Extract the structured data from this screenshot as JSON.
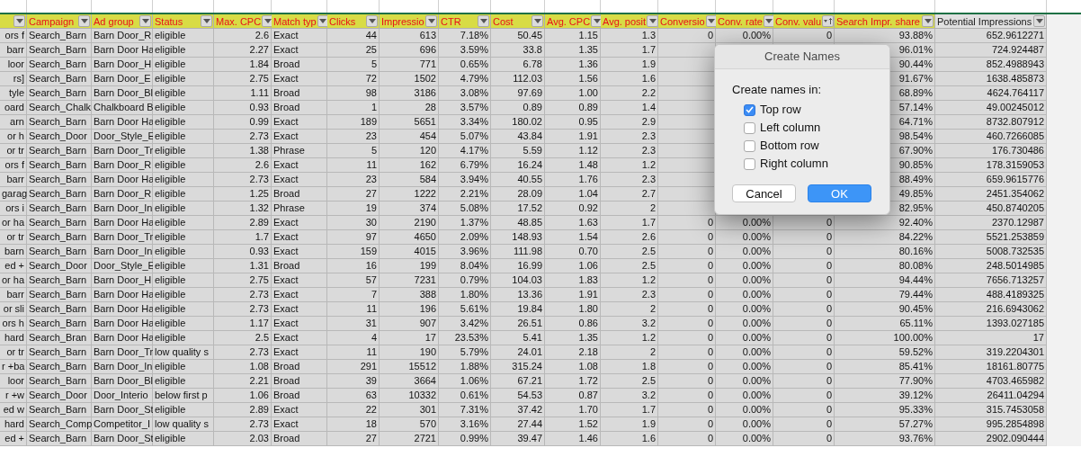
{
  "sheet": {
    "columns": [
      {
        "kind": "text",
        "highlighted": true,
        "sorted": false
      },
      {
        "label": "Campaign",
        "kind": "text",
        "highlighted": true,
        "sorted": false
      },
      {
        "label": "Ad group",
        "kind": "text",
        "highlighted": true,
        "sorted": false
      },
      {
        "label": "Status",
        "kind": "text",
        "highlighted": true,
        "sorted": false
      },
      {
        "label": "Max. CPC",
        "kind": "number",
        "highlighted": true,
        "sorted": false
      },
      {
        "label": "Match typ",
        "kind": "text",
        "highlighted": true,
        "sorted": false
      },
      {
        "label": "Clicks",
        "kind": "number",
        "highlighted": true,
        "sorted": false
      },
      {
        "label": "Impressio",
        "kind": "number",
        "highlighted": true,
        "sorted": false
      },
      {
        "label": "CTR",
        "kind": "number",
        "highlighted": true,
        "sorted": false
      },
      {
        "label": "Cost",
        "kind": "number",
        "highlighted": true,
        "sorted": false
      },
      {
        "label": "Avg. CPC",
        "kind": "number",
        "highlighted": true,
        "sorted": false
      },
      {
        "label": "Avg. posit",
        "kind": "number",
        "highlighted": true,
        "sorted": false
      },
      {
        "label": "Conversio",
        "kind": "number",
        "highlighted": true,
        "sorted": false
      },
      {
        "label": "Conv. rate",
        "kind": "number",
        "highlighted": true,
        "sorted": false
      },
      {
        "label": "Conv. valu",
        "kind": "number",
        "highlighted": true,
        "sorted": true
      },
      {
        "label": "Search Impr. share",
        "kind": "number",
        "highlighted": true,
        "sorted": false
      },
      {
        "label": "Potential Impressions",
        "kind": "number",
        "highlighted": false,
        "sorted": false
      }
    ],
    "rows": [
      [
        "ors f",
        "Search_Barn",
        "Barn Door_R",
        "eligible",
        "2.6",
        "Exact",
        "44",
        "613",
        "7.18%",
        "50.45",
        "1.15",
        "1.3",
        "0",
        "0.00%",
        "0",
        "93.88%",
        "652.9612271"
      ],
      [
        "barr",
        "Search_Barn",
        "Barn Door Ha",
        "eligible",
        "2.27",
        "Exact",
        "25",
        "696",
        "3.59%",
        "33.8",
        "1.35",
        "1.7",
        null,
        null,
        null,
        "96.01%",
        "724.924487"
      ],
      [
        "loor",
        "Search_Barn",
        "Barn Door_H",
        "eligible",
        "1.84",
        "Broad",
        "5",
        "771",
        "0.65%",
        "6.78",
        "1.36",
        "1.9",
        null,
        null,
        null,
        "90.44%",
        "852.4988943"
      ],
      [
        "rs]",
        "Search_Barn",
        "Barn Door_E",
        "eligible",
        "2.75",
        "Exact",
        "72",
        "1502",
        "4.79%",
        "112.03",
        "1.56",
        "1.6",
        null,
        null,
        null,
        "91.67%",
        "1638.485873"
      ],
      [
        "tyle",
        "Search_Barn",
        "Barn Door_Bl",
        "eligible",
        "1.11",
        "Broad",
        "98",
        "3186",
        "3.08%",
        "97.69",
        "1.00",
        "2.2",
        null,
        null,
        null,
        "68.89%",
        "4624.764117"
      ],
      [
        "oard",
        "Search_Chalk",
        "Chalkboard B",
        "eligible",
        "0.93",
        "Broad",
        "1",
        "28",
        "3.57%",
        "0.89",
        "0.89",
        "1.4",
        null,
        null,
        null,
        "57.14%",
        "49.00245012"
      ],
      [
        "arn",
        "Search_Barn",
        "Barn Door Ha",
        "eligible",
        "0.99",
        "Exact",
        "189",
        "5651",
        "3.34%",
        "180.02",
        "0.95",
        "2.9",
        null,
        null,
        null,
        "64.71%",
        "8732.807912"
      ],
      [
        "or h",
        "Search_Door",
        "Door_Style_E",
        "eligible",
        "2.73",
        "Exact",
        "23",
        "454",
        "5.07%",
        "43.84",
        "1.91",
        "2.3",
        null,
        null,
        null,
        "98.54%",
        "460.7266085"
      ],
      [
        "or tr",
        "Search_Barn",
        "Barn Door_Tr",
        "eligible",
        "1.38",
        "Phrase",
        "5",
        "120",
        "4.17%",
        "5.59",
        "1.12",
        "2.3",
        null,
        null,
        null,
        "67.90%",
        "176.730486"
      ],
      [
        "ors f",
        "Search_Barn",
        "Barn Door_R",
        "eligible",
        "2.6",
        "Exact",
        "11",
        "162",
        "6.79%",
        "16.24",
        "1.48",
        "1.2",
        null,
        null,
        null,
        "90.85%",
        "178.3159053"
      ],
      [
        "barr",
        "Search_Barn",
        "Barn Door Ha",
        "eligible",
        "2.73",
        "Exact",
        "23",
        "584",
        "3.94%",
        "40.55",
        "1.76",
        "2.3",
        null,
        null,
        null,
        "88.49%",
        "659.9615776"
      ],
      [
        "garag",
        "Search_Barn",
        "Barn Door_R",
        "eligible",
        "1.25",
        "Broad",
        "27",
        "1222",
        "2.21%",
        "28.09",
        "1.04",
        "2.7",
        null,
        null,
        null,
        "49.85%",
        "2451.354062"
      ],
      [
        "ors i",
        "Search_Barn",
        "Barn Door_In",
        "eligible",
        "1.32",
        "Phrase",
        "19",
        "374",
        "5.08%",
        "17.52",
        "0.92",
        "2",
        null,
        null,
        null,
        "82.95%",
        "450.8740205"
      ],
      [
        "or ha",
        "Search_Barn",
        "Barn Door Ha",
        "eligible",
        "2.89",
        "Exact",
        "30",
        "2190",
        "1.37%",
        "48.85",
        "1.63",
        "1.7",
        "0",
        "0.00%",
        "0",
        "92.40%",
        "2370.12987"
      ],
      [
        "or tr",
        "Search_Barn",
        "Barn Door_Tr",
        "eligible",
        "1.7",
        "Exact",
        "97",
        "4650",
        "2.09%",
        "148.93",
        "1.54",
        "2.6",
        "0",
        "0.00%",
        "0",
        "84.22%",
        "5521.253859"
      ],
      [
        "barn",
        "Search_Barn",
        "Barn Door_In",
        "eligible",
        "0.93",
        "Exact",
        "159",
        "4015",
        "3.96%",
        "111.98",
        "0.70",
        "2.5",
        "0",
        "0.00%",
        "0",
        "80.16%",
        "5008.732535"
      ],
      [
        "ed +",
        "Search_Door",
        "Door_Style_E",
        "eligible",
        "1.31",
        "Broad",
        "16",
        "199",
        "8.04%",
        "16.99",
        "1.06",
        "2.5",
        "0",
        "0.00%",
        "0",
        "80.08%",
        "248.5014985"
      ],
      [
        "or ha",
        "Search_Barn",
        "Barn Door_H",
        "eligible",
        "2.75",
        "Exact",
        "57",
        "7231",
        "0.79%",
        "104.03",
        "1.83",
        "1.2",
        "0",
        "0.00%",
        "0",
        "94.44%",
        "7656.713257"
      ],
      [
        "barr",
        "Search_Barn",
        "Barn Door Ha",
        "eligible",
        "2.73",
        "Exact",
        "7",
        "388",
        "1.80%",
        "13.36",
        "1.91",
        "2.3",
        "0",
        "0.00%",
        "0",
        "79.44%",
        "488.4189325"
      ],
      [
        "or sli",
        "Search_Barn",
        "Barn Door Ha",
        "eligible",
        "2.73",
        "Exact",
        "11",
        "196",
        "5.61%",
        "19.84",
        "1.80",
        "2",
        "0",
        "0.00%",
        "0",
        "90.45%",
        "216.6943062"
      ],
      [
        "ors h",
        "Search_Barn",
        "Barn Door Ha",
        "eligible",
        "1.17",
        "Exact",
        "31",
        "907",
        "3.42%",
        "26.51",
        "0.86",
        "3.2",
        "0",
        "0.00%",
        "0",
        "65.11%",
        "1393.027185"
      ],
      [
        "hard",
        "Search_Bran",
        "Barn Door Ha",
        "eligible",
        "2.5",
        "Exact",
        "4",
        "17",
        "23.53%",
        "5.41",
        "1.35",
        "1.2",
        "0",
        "0.00%",
        "0",
        "100.00%",
        "17"
      ],
      [
        "or tr",
        "Search_Barn",
        "Barn Door_Tr",
        "low quality s",
        "2.73",
        "Exact",
        "11",
        "190",
        "5.79%",
        "24.01",
        "2.18",
        "2",
        "0",
        "0.00%",
        "0",
        "59.52%",
        "319.2204301"
      ],
      [
        "r +ba",
        "Search_Barn",
        "Barn Door_In",
        "eligible",
        "1.08",
        "Broad",
        "291",
        "15512",
        "1.88%",
        "315.24",
        "1.08",
        "1.8",
        "0",
        "0.00%",
        "0",
        "85.41%",
        "18161.80775"
      ],
      [
        "loor",
        "Search_Barn",
        "Barn Door_Bl",
        "eligible",
        "2.21",
        "Broad",
        "39",
        "3664",
        "1.06%",
        "67.21",
        "1.72",
        "2.5",
        "0",
        "0.00%",
        "0",
        "77.90%",
        "4703.465982"
      ],
      [
        "r +w",
        "Search_Door",
        "Door_Interio",
        "below first p",
        "1.06",
        "Broad",
        "63",
        "10332",
        "0.61%",
        "54.53",
        "0.87",
        "3.2",
        "0",
        "0.00%",
        "0",
        "39.12%",
        "26411.04294"
      ],
      [
        "ed w",
        "Search_Barn",
        "Barn Door_St",
        "eligible",
        "2.89",
        "Exact",
        "22",
        "301",
        "7.31%",
        "37.42",
        "1.70",
        "1.7",
        "0",
        "0.00%",
        "0",
        "95.33%",
        "315.7453058"
      ],
      [
        "hard",
        "Search_Comp",
        "Competitor_I",
        "low quality s",
        "2.73",
        "Exact",
        "18",
        "570",
        "3.16%",
        "27.44",
        "1.52",
        "1.9",
        "0",
        "0.00%",
        "0",
        "57.27%",
        "995.2854898"
      ],
      [
        "ed +",
        "Search_Barn",
        "Barn Door_St",
        "eligible",
        "2.03",
        "Broad",
        "27",
        "2721",
        "0.99%",
        "39.47",
        "1.46",
        "1.6",
        "0",
        "0.00%",
        "0",
        "93.76%",
        "2902.090444"
      ]
    ]
  },
  "dialog": {
    "title": "Create Names",
    "prompt": "Create names in:",
    "options": [
      {
        "label": "Top row",
        "checked": true
      },
      {
        "label": "Left column",
        "checked": false
      },
      {
        "label": "Bottom row",
        "checked": false
      },
      {
        "label": "Right column",
        "checked": false
      }
    ],
    "buttons": [
      {
        "label": "Cancel",
        "kind": "default"
      },
      {
        "label": "OK",
        "kind": "primary"
      }
    ]
  }
}
